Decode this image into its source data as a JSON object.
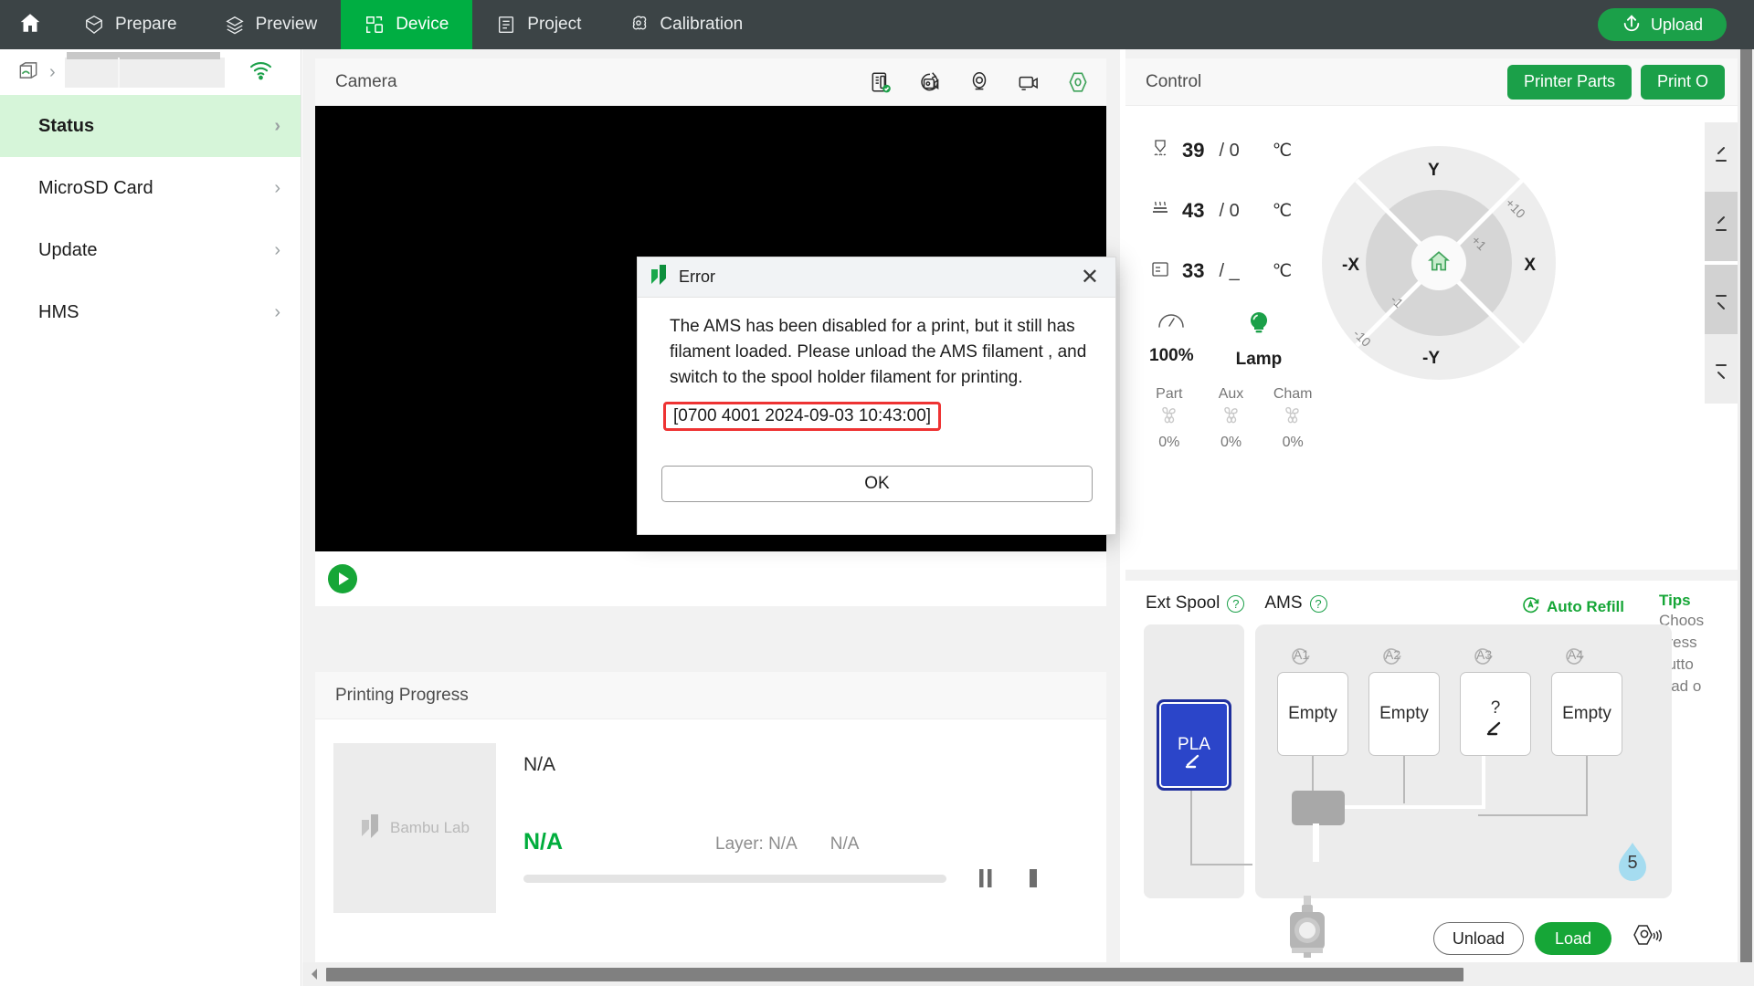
{
  "topnav": {
    "home_icon": "home-icon",
    "items": [
      {
        "label": "Prepare",
        "icon": "prepare-icon",
        "active": false
      },
      {
        "label": "Preview",
        "icon": "preview-layers-icon",
        "active": false
      },
      {
        "label": "Device",
        "icon": "device-icon",
        "active": true
      },
      {
        "label": "Project",
        "icon": "project-list-icon",
        "active": false
      },
      {
        "label": "Calibration",
        "icon": "calibration-icon",
        "active": false
      }
    ],
    "upload_label": "Upload",
    "upload_icon": "upload-arrow-icon",
    "active_color": "#00ae42",
    "bar_color": "#3c4446"
  },
  "sidebar": {
    "printer_icon": "printer-box-icon",
    "printer_name": "",
    "wifi_icon": "wifi-icon",
    "items": [
      {
        "label": "Status",
        "active": true
      },
      {
        "label": "MicroSD Card",
        "active": false
      },
      {
        "label": "Update",
        "active": false
      },
      {
        "label": "HMS",
        "active": false
      }
    ],
    "highlight_color": "#d6f5d9"
  },
  "camera": {
    "title": "Camera",
    "icons": [
      "sd-card-recording-icon",
      "timelapse-icon",
      "camera-lens-icon",
      "video-camera-icon",
      "nozzle-cam-icon"
    ],
    "play_icon": "play-icon"
  },
  "progress": {
    "title": "Printing Progress",
    "thumbnail_brand": "Bambu Lab",
    "job_name": "N/A",
    "percent": "N/A",
    "layer_label": "Layer: N/A",
    "time_remaining": "N/A",
    "bar_value": 0,
    "pause_icon": "pause-icon",
    "stop_icon": "stop-icon"
  },
  "control": {
    "title": "Control",
    "buttons": [
      {
        "label": "Printer Parts"
      },
      {
        "label": "Print O"
      }
    ],
    "temperatures": [
      {
        "icon": "nozzle-icon",
        "current": "39",
        "target": "0",
        "unit": "℃"
      },
      {
        "icon": "bed-icon",
        "current": "43",
        "target": "0",
        "unit": "℃"
      },
      {
        "icon": "chamber-icon",
        "current": "33",
        "target": "_",
        "unit": "℃"
      }
    ],
    "speed": {
      "icon": "speed-gauge-icon",
      "label": "100%"
    },
    "lamp": {
      "icon": "lamp-icon",
      "label": "Lamp",
      "color": "#1ba049"
    },
    "fans": [
      {
        "name": "Part",
        "value": "0%"
      },
      {
        "name": "Aux",
        "value": "0%"
      },
      {
        "name": "Cham",
        "value": "0%"
      }
    ],
    "axis": {
      "home_icon": "home-axis-icon",
      "y_plus": "Y",
      "y_minus": "-Y",
      "x_plus": "X",
      "x_minus": "-X",
      "step_plus_10": "+10",
      "step_plus_1": "+1",
      "step_minus_1": "-1",
      "step_minus_10": "-10"
    },
    "z_buttons": [
      "z-up-10-icon",
      "z-up-1-icon",
      "z-down-1-icon",
      "z-down-10-icon"
    ]
  },
  "ams": {
    "ext_spool_label": "Ext Spool",
    "ams_label": "AMS",
    "help_icon": "question-mark-icon",
    "auto_refill_label": "Auto Refill",
    "auto_refill_icon": "auto-refill-icon",
    "ext_spool_slot": {
      "label": "PLA",
      "color": "#2b45c9",
      "edit_icon": "edit-pen-icon"
    },
    "slots": [
      {
        "tag": "A1",
        "label": "Empty",
        "edit_icon": ""
      },
      {
        "tag": "A2",
        "label": "Empty",
        "edit_icon": ""
      },
      {
        "tag": "A3",
        "label": "?",
        "edit_icon": "edit-pen-icon"
      },
      {
        "tag": "A4",
        "label": "Empty",
        "edit_icon": ""
      }
    ],
    "humidity": {
      "value": "5",
      "icon": "humidity-drop-icon",
      "color": "#a5dcf0"
    },
    "unload_label": "Unload",
    "load_label": "Load",
    "extruder_icon": "extruder-icon",
    "nozzle_settings_icon": "nozzle-settings-icon",
    "tips_title": "Tips",
    "tips_lines": [
      "Choos",
      "press",
      "butto",
      "load o"
    ]
  },
  "dialog": {
    "icon": "bambu-logo-icon",
    "title": "Error",
    "close_icon": "close-icon",
    "message": "The AMS has been disabled for a print, but it still has filament loaded. Please unload the AMS filament , and switch to the spool holder filament for printing.",
    "error_code": "[0700 4001 2024-09-03 10:43:00]",
    "error_code_border": "#ee3333",
    "ok_label": "OK"
  },
  "scrollbars": {
    "vertical_icon": "vertical-scrollbar",
    "horizontal_icon": "horizontal-scrollbar",
    "left_arrow_icon": "scroll-left-arrow-icon"
  }
}
